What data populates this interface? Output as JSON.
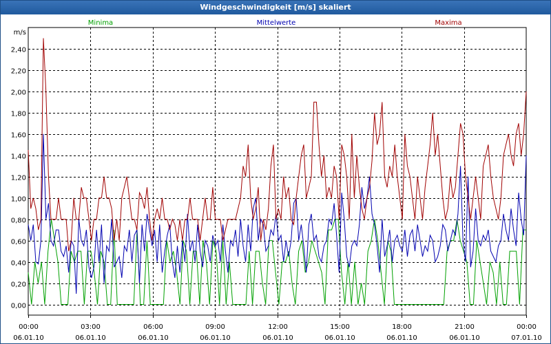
{
  "window": {
    "title": "Windgeschwindigkeit [m/s] skaliert"
  },
  "colors": {
    "min": "#00a000",
    "mean": "#0000b0",
    "max": "#a00000",
    "grid": "#000000"
  },
  "chart_data": {
    "type": "line",
    "title": "Windgeschwindigkeit [m/s] skaliert",
    "ylabel": "m/s",
    "ylim": [
      -0.1,
      2.6
    ],
    "xlim": [
      0,
      24
    ],
    "grid": true,
    "legend_position": "top",
    "y_ticks": [
      "0,00",
      "0,20",
      "0,40",
      "0,60",
      "0,80",
      "1,00",
      "1,20",
      "1,40",
      "1,60",
      "1,80",
      "2,00",
      "2,20",
      "2,40"
    ],
    "x_tick_labels": [
      {
        "time": "00:00",
        "date": "06.01.10"
      },
      {
        "time": "03:00",
        "date": "06.01.10"
      },
      {
        "time": "06:00",
        "date": "06.01.10"
      },
      {
        "time": "09:00",
        "date": "06.01.10"
      },
      {
        "time": "12:00",
        "date": "06.01.10"
      },
      {
        "time": "15:00",
        "date": "06.01.10"
      },
      {
        "time": "18:00",
        "date": "06.01.10"
      },
      {
        "time": "21:00",
        "date": "06.01.10"
      },
      {
        "time": "00:00",
        "date": "07.01.10"
      }
    ],
    "series": [
      {
        "name": "Minima",
        "color": "#00a000",
        "values": [
          0.3,
          0.0,
          0.4,
          0.2,
          0.4,
          0.0,
          0.5,
          0.8,
          0.6,
          0.4,
          0.0,
          0.0,
          0.0,
          0.5,
          0.4,
          0.5,
          0.5,
          0.0,
          0.5,
          0.5,
          0.3,
          0.0,
          0.5,
          0.4,
          0.0,
          0.0,
          0.7,
          0.0,
          0.0,
          0.0,
          0.0,
          0.0,
          0.0,
          0.7,
          0.0,
          0.0,
          0.6,
          0.0,
          0.0,
          0.0,
          0.0,
          0.0,
          0.6,
          0.4,
          0.5,
          0.3,
          0.0,
          0.6,
          0.5,
          0.0,
          0.5,
          0.5,
          0.0,
          0.6,
          0.4,
          0.0,
          0.6,
          0.5,
          0.0,
          0.6,
          0.0,
          0.4,
          0.0,
          0.0,
          0.0,
          0.0,
          0.0,
          0.5,
          0.0,
          0.5,
          0.5,
          0.2,
          0.0,
          0.6,
          0.6,
          0.3,
          0.0,
          0.4,
          0.4,
          0.5,
          0.2,
          0.0,
          0.5,
          0.6,
          0.3,
          0.4,
          0.6,
          0.5,
          0.4,
          0.3,
          0.0,
          0.7,
          0.7,
          0.8,
          0.8,
          0.3,
          0.0,
          0.4,
          0.0,
          0.4,
          0.0,
          0.2,
          0.0,
          0.5,
          0.6,
          0.8,
          0.6,
          0.3,
          0.0,
          0.6,
          0.5,
          0.0,
          0.0,
          0.0,
          0.0,
          0.0,
          0.0,
          0.0,
          0.0,
          0.0,
          0.0,
          0.0,
          0.0,
          0.0,
          0.0,
          0.0,
          0.0,
          0.5,
          0.6,
          0.6,
          0.8,
          0.6,
          0.5,
          0.4,
          0.0,
          0.0,
          0.6,
          0.4,
          0.2,
          0.0,
          0.4,
          0.3,
          0.0,
          0.4,
          0.0,
          0.0,
          0.5,
          0.5,
          0.5,
          0.0,
          0.7,
          0.7
        ]
      },
      {
        "name": "Mittelwerte",
        "color": "#0000b0",
        "values": [
          0.75,
          0.6,
          0.75,
          0.4,
          0.38,
          0.6,
          1.6,
          0.8,
          0.95,
          0.6,
          0.55,
          0.7,
          0.7,
          0.5,
          0.45,
          0.55,
          0.3,
          0.6,
          0.55,
          0.1,
          0.8,
          0.6,
          0.55,
          0.7,
          0.35,
          0.25,
          0.35,
          0.7,
          0.4,
          0.75,
          0.2,
          0.55,
          0.5,
          0.8,
          0.35,
          0.4,
          0.45,
          0.25,
          0.55,
          0.5,
          0.7,
          0.4,
          0.65,
          0.7,
          0.2,
          0.75,
          0.5,
          0.85,
          0.7,
          0.55,
          0.7,
          0.4,
          0.75,
          0.3,
          0.5,
          0.65,
          0.75,
          0.4,
          0.25,
          0.55,
          0.3,
          0.6,
          0.4,
          0.85,
          0.5,
          0.6,
          0.4,
          0.75,
          0.5,
          0.35,
          0.6,
          0.55,
          0.4,
          0.65,
          0.55,
          0.6,
          0.4,
          0.75,
          0.5,
          0.3,
          0.6,
          0.55,
          0.7,
          0.45,
          0.8,
          0.55,
          0.4,
          0.75,
          0.5,
          0.9,
          1.0,
          0.6,
          0.8,
          0.75,
          0.5,
          0.55,
          0.7,
          0.65,
          0.85,
          0.6,
          0.65,
          0.4,
          0.6,
          0.45,
          0.6,
          0.95,
          1.0,
          0.6,
          0.75,
          0.55,
          0.3,
          0.75,
          0.85,
          0.6,
          0.65,
          0.45,
          0.4,
          0.55,
          0.6,
          0.8,
          0.75,
          0.95,
          0.65,
          0.3,
          1.05,
          0.8,
          0.45,
          0.35,
          0.55,
          0.6,
          0.55,
          0.75,
          1.1,
          0.9,
          1.0,
          1.2,
          0.85,
          0.75,
          0.55,
          0.3,
          0.8,
          0.45,
          0.55,
          0.7,
          0.4,
          0.6,
          0.65,
          0.55,
          0.5,
          0.7,
          0.45,
          0.65,
          0.7,
          0.5,
          0.75,
          0.6,
          0.45,
          0.55,
          0.5,
          0.65,
          0.6,
          0.4,
          0.45,
          0.55,
          0.75,
          0.7,
          0.5,
          0.6,
          0.7,
          0.65,
          0.85,
          1.3,
          0.6,
          0.4,
          1.2,
          0.35,
          0.5,
          0.9,
          0.6,
          0.55,
          0.65,
          0.6,
          0.7,
          0.5,
          0.45,
          0.4,
          0.55,
          0.6,
          0.85,
          0.7,
          0.6,
          0.9,
          0.7,
          0.55,
          1.05,
          0.8,
          0.65,
          1.4
        ]
      },
      {
        "name": "Maxima",
        "color": "#a00000",
        "values": [
          1.45,
          0.9,
          1.0,
          0.9,
          0.7,
          0.8,
          2.5,
          2.0,
          1.2,
          0.8,
          0.8,
          0.8,
          1.0,
          0.8,
          0.8,
          0.8,
          0.5,
          0.6,
          1.0,
          0.8,
          0.8,
          1.1,
          1.0,
          1.0,
          0.8,
          0.6,
          0.8,
          0.8,
          1.0,
          1.0,
          1.2,
          1.0,
          1.0,
          0.9,
          0.6,
          0.8,
          0.6,
          1.0,
          1.1,
          1.2,
          1.0,
          0.8,
          0.8,
          0.7,
          1.05,
          1.0,
          0.9,
          1.1,
          0.8,
          0.6,
          0.8,
          0.9,
          0.8,
          1.0,
          0.8,
          0.8,
          0.7,
          0.8,
          0.75,
          0.6,
          0.8,
          0.6,
          0.8,
          0.8,
          1.0,
          0.8,
          0.8,
          0.8,
          0.6,
          0.8,
          1.0,
          0.8,
          0.8,
          1.1,
          0.8,
          0.8,
          0.8,
          0.6,
          0.7,
          0.8,
          0.8,
          0.8,
          0.8,
          0.9,
          1.0,
          1.3,
          1.2,
          1.5,
          1.0,
          0.8,
          0.9,
          1.1,
          0.6,
          0.8,
          0.7,
          0.9,
          1.3,
          1.5,
          0.8,
          0.9,
          0.8,
          1.2,
          1.0,
          1.1,
          0.8,
          0.75,
          1.0,
          1.2,
          1.4,
          1.5,
          1.0,
          1.1,
          1.2,
          1.9,
          1.9,
          1.5,
          1.2,
          1.4,
          1.0,
          1.1,
          1.0,
          1.3,
          1.2,
          0.8,
          1.5,
          1.4,
          1.2,
          0.8,
          1.6,
          1.0,
          1.4,
          1.1,
          0.9,
          0.8,
          1.0,
          1.1,
          1.35,
          1.8,
          1.5,
          1.6,
          1.9,
          1.2,
          1.1,
          1.3,
          1.2,
          1.5,
          1.2,
          1.0,
          0.8,
          1.6,
          1.3,
          1.2,
          1.0,
          0.8,
          1.2,
          1.0,
          0.8,
          1.1,
          1.3,
          1.5,
          1.8,
          1.4,
          1.6,
          1.3,
          1.0,
          0.8,
          0.9,
          1.2,
          1.0,
          1.1,
          1.4,
          1.7,
          1.6,
          1.2,
          1.0,
          0.8,
          1.0,
          1.2,
          1.0,
          0.8,
          1.3,
          1.4,
          1.5,
          1.2,
          1.0,
          0.9,
          0.8,
          1.0,
          1.4,
          1.5,
          1.6,
          1.4,
          1.3,
          1.6,
          1.7,
          1.4,
          1.6,
          2.0
        ]
      }
    ]
  }
}
